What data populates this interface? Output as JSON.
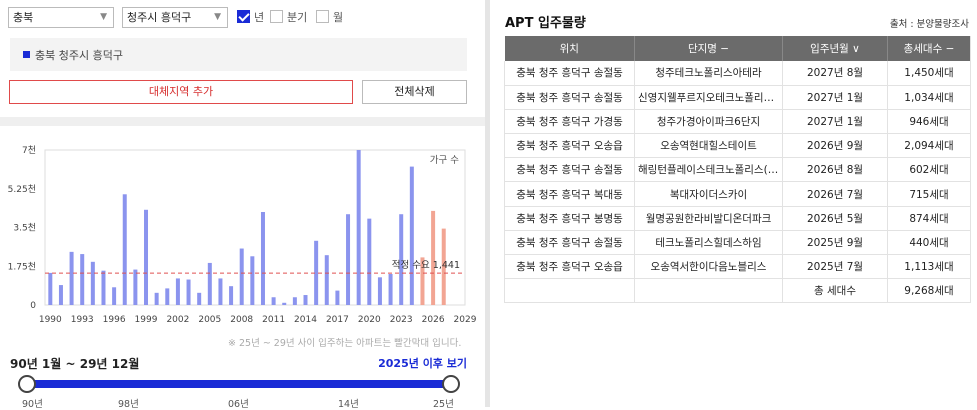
{
  "filters": {
    "province": "충북",
    "district": "청주시 흥덕구",
    "options": [
      {
        "label": "년",
        "checked": true
      },
      {
        "label": "분기",
        "checked": false
      },
      {
        "label": "월",
        "checked": false
      }
    ]
  },
  "selected_region": "충북 청주시 흥덕구",
  "buttons": {
    "add_region": "대체지역 추가",
    "clear_all": "전체삭제"
  },
  "chart_note": "※ 25년 ~ 29년 사이 입주하는 아파트는 빨간막대 입니다.",
  "period_label": "90년 1월 ~ 29년 12월",
  "after_link": "2025년 이후 보기",
  "slider_ticks": [
    "90년",
    "98년",
    "06년",
    "14년",
    "25년"
  ],
  "chart_data": {
    "type": "bar",
    "legend": "가구 수",
    "ylabels": [
      "0",
      "1.75천",
      "3.5천",
      "5.25천",
      "7천"
    ],
    "ylim": [
      0,
      7000
    ],
    "x": [
      1990,
      1991,
      1992,
      1993,
      1994,
      1995,
      1996,
      1997,
      1998,
      1999,
      2000,
      2001,
      2002,
      2003,
      2004,
      2005,
      2006,
      2007,
      2008,
      2009,
      2010,
      2011,
      2012,
      2013,
      2014,
      2015,
      2016,
      2017,
      2018,
      2019,
      2020,
      2021,
      2022,
      2023,
      2024,
      2025,
      2026,
      2027
    ],
    "values": [
      1450,
      900,
      2400,
      2300,
      1950,
      1550,
      800,
      5000,
      1600,
      4300,
      550,
      750,
      1200,
      1150,
      550,
      1900,
      1200,
      850,
      2550,
      2200,
      4200,
      350,
      100,
      350,
      450,
      2900,
      2250,
      650,
      4100,
      7000,
      3900,
      1250,
      1400,
      4100,
      6250,
      2150,
      4250,
      3450
    ],
    "highlight_from": 2025,
    "xticks": [
      "1990",
      "1993",
      "1996",
      "1999",
      "2002",
      "2005",
      "2008",
      "2011",
      "2014",
      "2017",
      "2020",
      "2023",
      "2026",
      "2029"
    ],
    "reference_line": {
      "label": "적정 수요 1,441",
      "value": 1441
    },
    "colors": {
      "normal": "#8b94ee",
      "future": "#f2a593",
      "ref": "#e05050"
    }
  },
  "right_panel": {
    "title": "APT 입주물량",
    "source": "출처 : 분양물량조사",
    "columns": [
      "위치",
      "단지명 −",
      "입주년월 ∨",
      "총세대수 −"
    ],
    "rows": [
      [
        "충북 청주 흥덕구 송절동",
        "청주테크노폴리스아테라",
        "2027년 8월",
        "1,450세대"
      ],
      [
        "충북 청주 흥덕구 송절동",
        "신영지웰푸르지오테크노폴리스센트…",
        "2027년 1월",
        "1,034세대"
      ],
      [
        "충북 청주 흥덕구 가경동",
        "청주가경아이파크6단지",
        "2027년 1월",
        "946세대"
      ],
      [
        "충북 청주 흥덕구 오송읍",
        "오송역현대힐스테이트",
        "2026년 9월",
        "2,094세대"
      ],
      [
        "충북 청주 흥덕구 송절동",
        "해링턴플레이스테크노폴리스(주상…",
        "2026년 8월",
        "602세대"
      ],
      [
        "충북 청주 흥덕구 복대동",
        "복대자이더스카이",
        "2026년 7월",
        "715세대"
      ],
      [
        "충북 청주 흥덕구 봉명동",
        "월명공원한라비발디온더파크",
        "2026년 5월",
        "874세대"
      ],
      [
        "충북 청주 흥덕구 송절동",
        "테크노폴리스힐데스하임",
        "2025년 9월",
        "440세대"
      ],
      [
        "충북 청주 흥덕구 오송읍",
        "오송역서한이다음노블리스",
        "2025년 7월",
        "1,113세대"
      ]
    ],
    "total_label": "총 세대수",
    "total_value": "9,268세대"
  }
}
